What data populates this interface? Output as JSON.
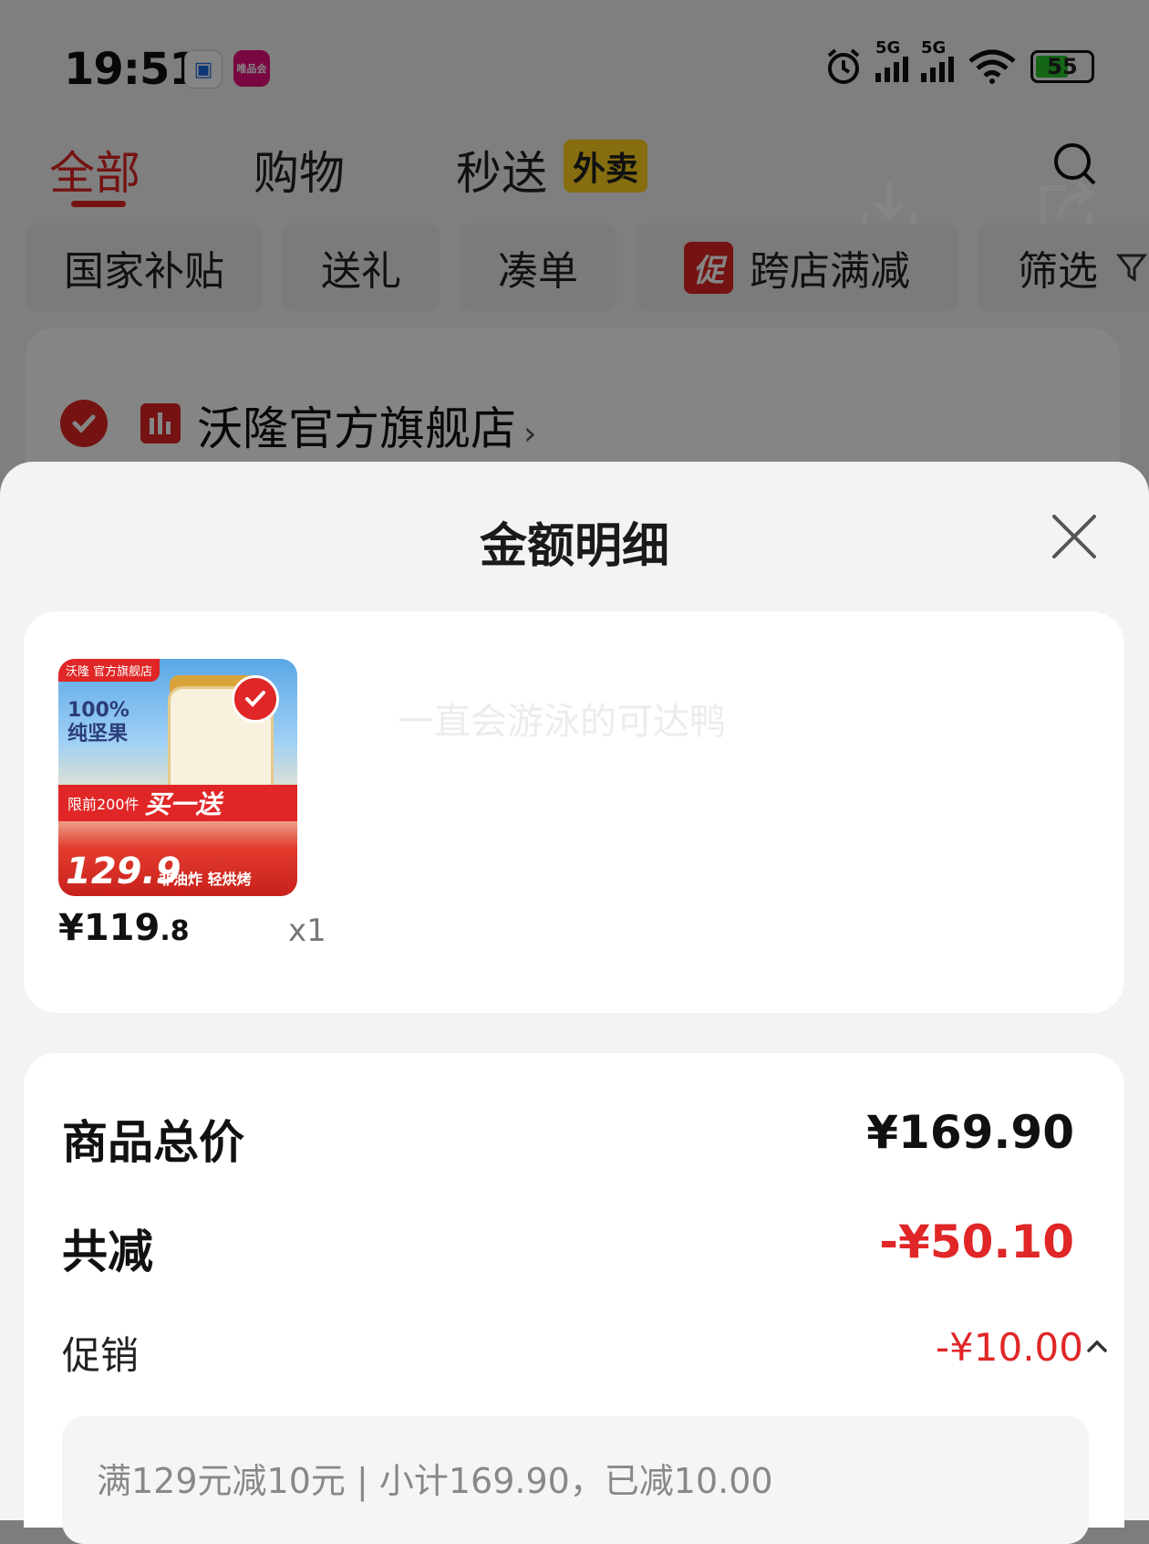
{
  "status_bar": {
    "time": "19:51",
    "app_icon_1": "▣",
    "app_icon_2": "唯品会",
    "signal_1_label": "5G",
    "signal_2_label": "5G",
    "battery": "55"
  },
  "tabs": [
    {
      "label": "全部",
      "active": true
    },
    {
      "label": "购物"
    },
    {
      "label": "秒送"
    }
  ],
  "tab_badge": "外卖",
  "chips": [
    {
      "label": "国家补贴"
    },
    {
      "label": "送礼"
    },
    {
      "label": "凑单"
    },
    {
      "label": "跨店满减",
      "badge": "促"
    },
    {
      "label": "筛选"
    }
  ],
  "store": {
    "name": "沃隆官方旗舰店",
    "arrow": "›"
  },
  "sheet": {
    "title": "金额明细",
    "product": {
      "thumb_store_tag": "沃隆 官方旗舰店",
      "thumb_line1": "100%",
      "thumb_line2": "纯坚果",
      "thumb_ribbon_small": "限前200件",
      "thumb_ribbon_big": "买一送",
      "thumb_price": "129.9",
      "thumb_tagline": "非油炸 轻烘烤",
      "price_main": "¥119",
      "price_decimal": ".8",
      "quantity": "x1",
      "watermark": "一直会游泳的可达鸭"
    },
    "summary": {
      "total_label": "商品总价",
      "total_value": "¥169.90",
      "discount_label": "共减",
      "discount_value": "-¥50.10",
      "promo_label": "促销",
      "promo_value": "-¥10.00",
      "promo_detail": "满129元减10元 | 小计169.90，已减10.00"
    }
  },
  "colors": {
    "accent_red": "#e02626",
    "badge_yellow": "#ffd21f"
  }
}
